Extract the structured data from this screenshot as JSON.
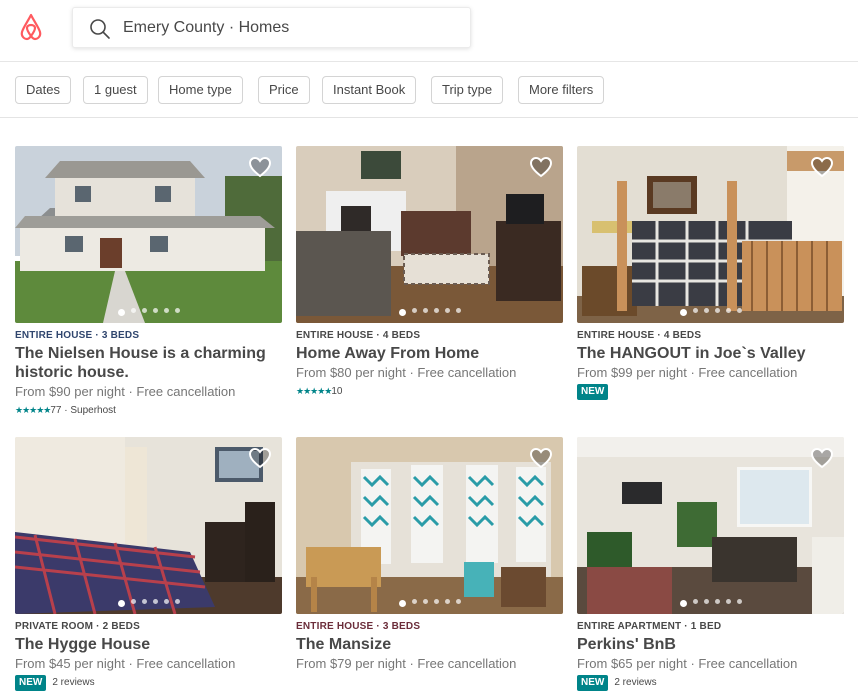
{
  "search": {
    "text": "Emery County · Homes"
  },
  "filters": [
    "Dates",
    "1 guest",
    "Home type",
    "Price",
    "Instant Book",
    "Trip type",
    "More filters"
  ],
  "listings": [
    {
      "type": "ENTIRE HOUSE · 3 BEDS",
      "type_color": "#30466E",
      "title": "The Nielsen House is a charming historic house.",
      "price": "From $90  per night · Free cancellation",
      "stars": "★★★★★",
      "reviews": "77 · Superhost",
      "badge": ""
    },
    {
      "type": "ENTIRE HOUSE · 4 BEDS",
      "type_color": "#484848",
      "title": "Home Away From Home",
      "price": "From $80  per night · Free cancellation",
      "stars": "★★★★★",
      "reviews": "10",
      "badge": ""
    },
    {
      "type": "ENTIRE HOUSE · 4 BEDS",
      "type_color": "#484848",
      "title": "The HANGOUT in Joe`s Valley",
      "price": "From $99  per night · Free cancellation",
      "stars": "",
      "reviews": "",
      "badge": "NEW"
    },
    {
      "type": "PRIVATE ROOM · 2 BEDS",
      "type_color": "#484848",
      "title": "The Hygge House",
      "price": "From $45  per night · Free cancellation",
      "stars": "",
      "reviews": "2 reviews",
      "badge": "NEW"
    },
    {
      "type": "ENTIRE HOUSE · 3 BEDS",
      "type_color": "#6B2D3A",
      "title": "The Mansize",
      "price": "From $79  per night · Free cancellation",
      "stars": "",
      "reviews": "",
      "badge": ""
    },
    {
      "type": "ENTIRE APARTMENT · 1 BED",
      "type_color": "#484848",
      "title": "Perkins' BnB",
      "price": "From $65  per night · Free cancellation",
      "stars": "",
      "reviews": "2 reviews",
      "badge": "NEW"
    }
  ],
  "colors": {
    "brand": "#FF5A5F",
    "teal": "#008489"
  },
  "icons": {
    "logo": "airbnb-logo",
    "search": "magnifier",
    "favorite": "heart-outline"
  }
}
